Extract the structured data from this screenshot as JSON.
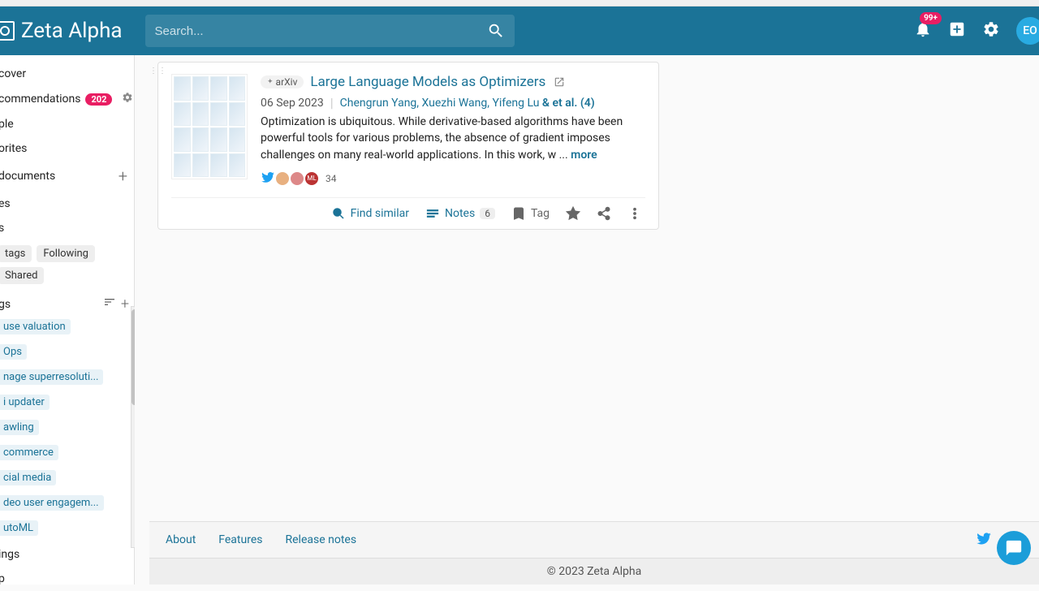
{
  "brand": "Zeta Alpha",
  "search": {
    "placeholder": "Search..."
  },
  "header": {
    "notif_badge": "99+",
    "avatar_initials": "EO"
  },
  "sidebar": {
    "nav": [
      {
        "label": "cover"
      },
      {
        "label": "commendations",
        "badge": "202",
        "gear": true
      },
      {
        "label": "ple"
      },
      {
        "label": "orites"
      },
      {
        "label": "documents",
        "plus": true
      },
      {
        "label": "es"
      },
      {
        "label": "s"
      }
    ],
    "tabs": [
      "tags",
      "Following",
      "Shared"
    ],
    "tags_header": "gs",
    "tags": [
      "use valuation",
      "Ops",
      "nage superresoluti...",
      "i updater",
      "awling",
      "commerce",
      "cial media",
      "deo user engagem...",
      "utoML"
    ],
    "bottom": [
      "ings",
      "p"
    ]
  },
  "card": {
    "source": "arXiv",
    "title": "Large Language Models as Optimizers",
    "date": "06 Sep 2023",
    "authors": "Chengrun Yang, Xuezhi Wang, Yifeng Lu",
    "etal": "& et al. (4)",
    "abstract": "Optimization is ubiquitous. While derivative-based algorithms have been powerful tools for various problems, the absence of gradient imposes challenges on many real-world applications. In this work, w ... ",
    "more": "more",
    "social_count": "34",
    "actions": {
      "find_similar": "Find similar",
      "notes": "Notes",
      "notes_count": "6",
      "tag": "Tag"
    }
  },
  "footer": {
    "links": [
      "About",
      "Features",
      "Release notes"
    ],
    "copyright": "© 2023 Zeta Alpha"
  }
}
